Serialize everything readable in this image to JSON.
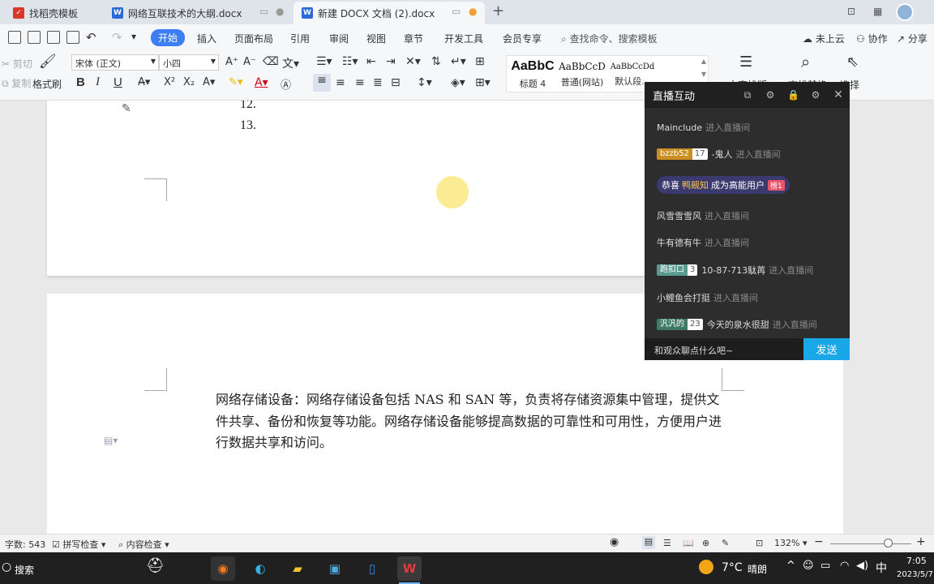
{
  "tabs": [
    {
      "label": "找稻壳模板",
      "icon": "wps-docer-icon",
      "color": "#d9372b"
    },
    {
      "label": "网络互联技术的大纲.docx",
      "icon": "wps-writer-icon",
      "color": "#2a6ad8"
    },
    {
      "label": "新建 DOCX 文档 (2).docx",
      "icon": "wps-writer-icon",
      "color": "#2a6ad8"
    }
  ],
  "tab_controls": {
    "new_tab": "+",
    "unsaved_dot": "●"
  },
  "menu": {
    "items": [
      "开始",
      "插入",
      "页面布局",
      "引用",
      "审阅",
      "视图",
      "章节",
      "开发工具",
      "会员专享"
    ],
    "search_placeholder": "查找命令、搜索模板",
    "cloud": "未上云",
    "collab": "协作",
    "share": "分享"
  },
  "ribbon": {
    "cut": "剪切",
    "copy": "复制",
    "format_painter": "格式刷",
    "font": "宋体 (正文)",
    "size": "小四",
    "bold": "B",
    "italic": "I",
    "underline": "U",
    "styles": [
      {
        "sample": "AaBbC",
        "label": "标题 4"
      },
      {
        "sample": "AaBbCcD",
        "label": "普通(网站)"
      },
      {
        "sample": "AaBbCcDd",
        "label": "默认段..."
      }
    ],
    "text_layout": "文字排版",
    "find_replace": "查找替换",
    "select": "选择"
  },
  "document": {
    "numbered_lines": [
      "12.",
      "13."
    ],
    "paragraph": "网络存储设备：网络存储设备包括 NAS 和 SAN 等，负责将存储资源集中管理，提供文件共享、备份和恢复等功能。网络存储设备能够提高数据的可靠性和可用性，方便用户进行数据共享和访问。"
  },
  "live_chat": {
    "title": "直播互动",
    "enter_text": "进入直播间",
    "messages": [
      {
        "user": "Mainclude"
      },
      {
        "badge": "bzzb52",
        "level": "17",
        "badge_color": "#c9901f",
        "user": "-鬼人"
      },
      {
        "user": "风雪雪雪风"
      },
      {
        "user": "牛有德有牛"
      },
      {
        "badge": "跑扣口",
        "level": "3",
        "badge_color": "#5a9b8f",
        "user": "10-87-713駄苒"
      },
      {
        "user": "小鲤鱼会打挺"
      },
      {
        "badge": "汎汎的",
        "level": "23",
        "badge_color": "#3e7a66",
        "user": "今天的泉水很甜"
      }
    ],
    "congrats": {
      "prefix": "恭喜",
      "name": "鸭觋知",
      "suffix": "成为高能用户",
      "tag": "榜1"
    },
    "input_placeholder": "和观众聊点什么吧~",
    "send": "发送"
  },
  "status": {
    "word_count": "字数: 543",
    "spell_check": "拼写检查",
    "content_check": "内容检查",
    "zoom": "132%"
  },
  "taskbar": {
    "search": "搜索",
    "weather_temp": "7°C",
    "weather_text": "晴朗",
    "ime": "中",
    "time": "7:05",
    "date": "2023/5/7"
  }
}
